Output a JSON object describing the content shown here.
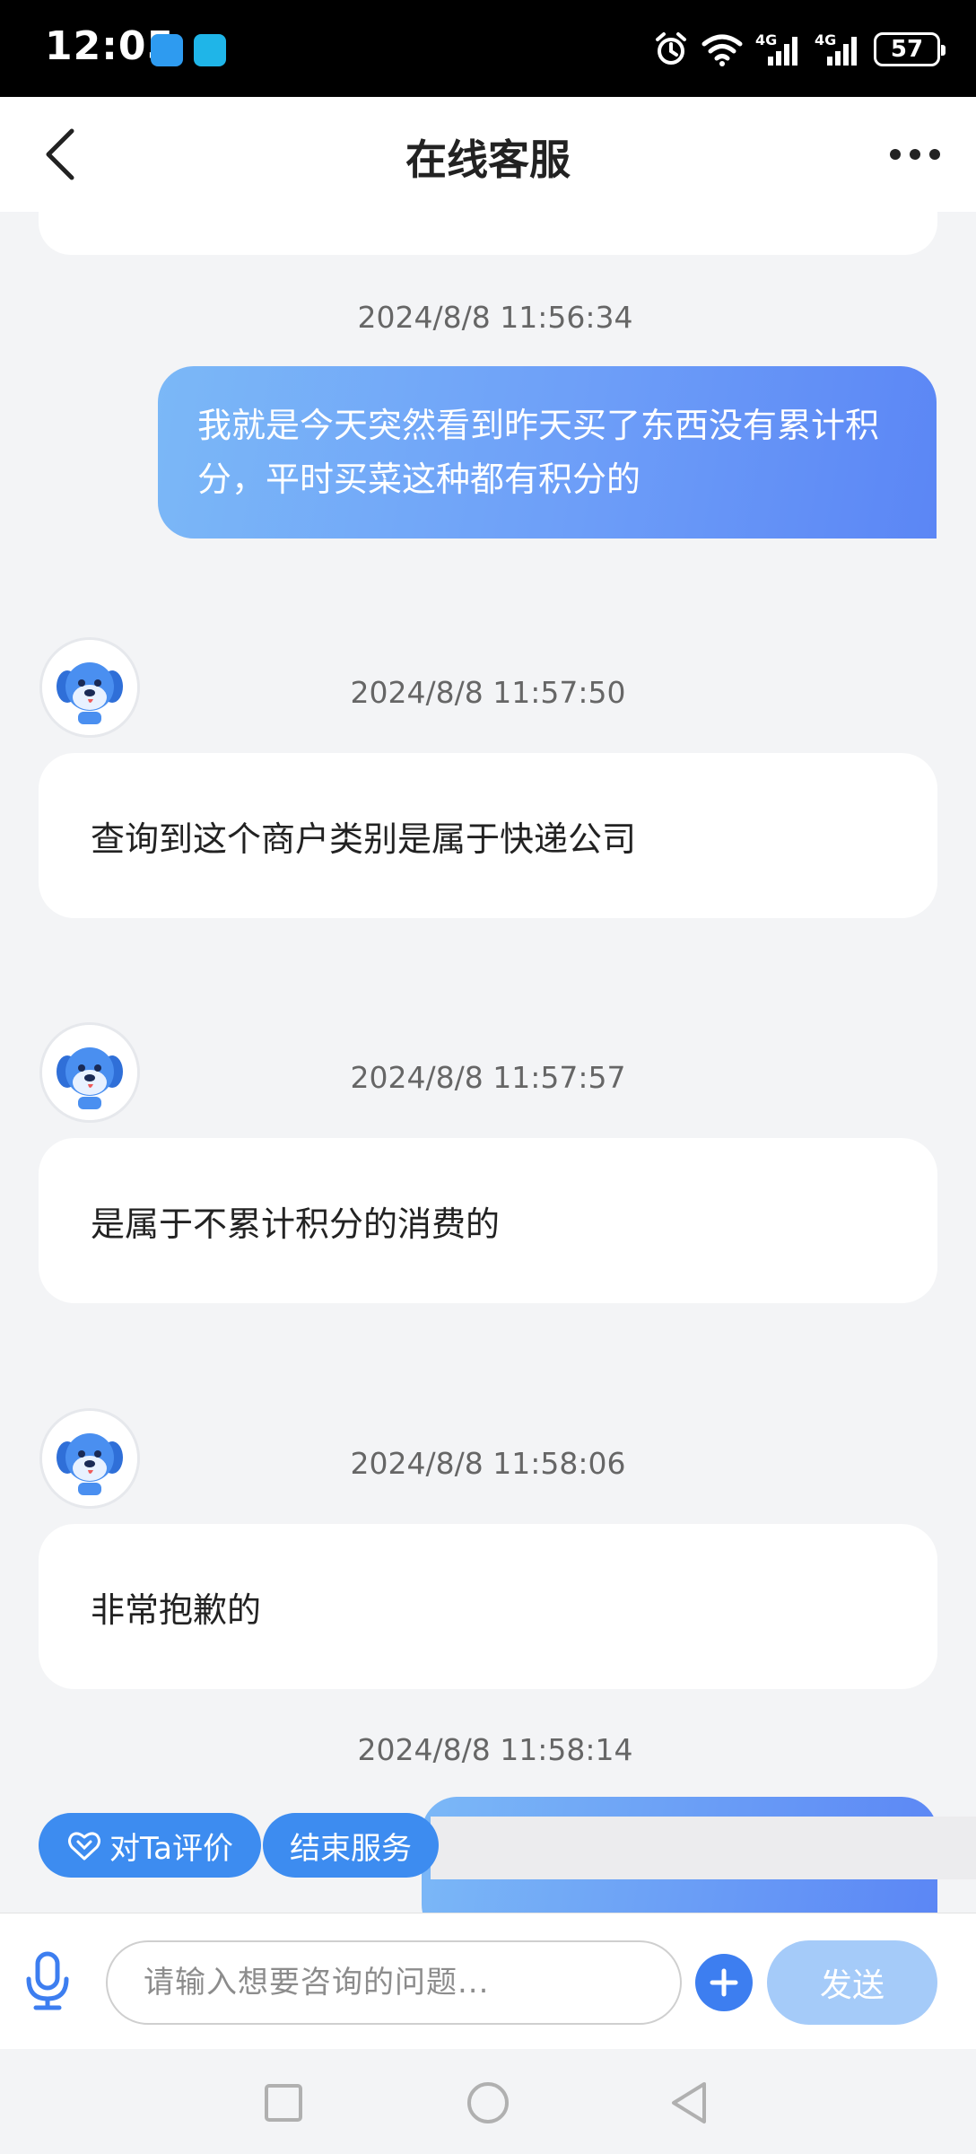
{
  "status_bar": {
    "time": "12:05",
    "battery": "57",
    "network_label_1": "4G",
    "network_label_2": "4G"
  },
  "header": {
    "title": "在线客服"
  },
  "messages": [
    {
      "from": "user",
      "time": "2024/8/8 11:56:34",
      "text": "我就是今天突然看到昨天买了东西没有累计积分，平时买菜这种都有积分的"
    },
    {
      "from": "agent",
      "time": "2024/8/8 11:57:50",
      "text": "查询到这个商户类别是属于快递公司"
    },
    {
      "from": "agent",
      "time": "2024/8/8 11:57:57",
      "text": "是属于不累计积分的消费的"
    },
    {
      "from": "agent",
      "time": "2024/8/8 11:58:06",
      "text": "非常抱歉的"
    },
    {
      "from": "user",
      "time": "2024/8/8 11:58:14",
      "text": ""
    }
  ],
  "quick_actions": {
    "rate": "对Ta评价",
    "end": "结束服务"
  },
  "input": {
    "placeholder": "请输入想要咨询的问题...",
    "send_label": "发送"
  },
  "colors": {
    "accent": "#3d8cf0",
    "user_bubble_start": "#7bb8f7",
    "user_bubble_end": "#5b86f5",
    "send_disabled": "#a5cbf9"
  }
}
